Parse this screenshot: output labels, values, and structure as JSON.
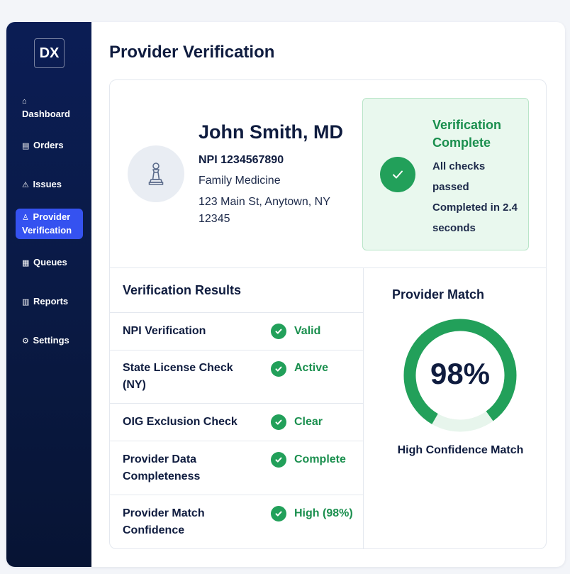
{
  "colors": {
    "sidebar_bg": "#0a1a45",
    "nav_active": "#3552f0",
    "success": "#22a05a",
    "success_text": "#1a8f4e",
    "success_bg": "#e9f8ee",
    "text_primary": "#0f1c3f"
  },
  "sidebar": {
    "logo": "DX",
    "items": [
      {
        "icon": "⌂",
        "icon_name": "home-icon",
        "label": "Dashboard",
        "active": false
      },
      {
        "icon": "▤",
        "icon_name": "orders-icon",
        "label": "Orders",
        "active": false
      },
      {
        "icon": "⚠",
        "icon_name": "warning-icon",
        "label": "Issues",
        "active": false
      },
      {
        "icon": "♙",
        "icon_name": "user-icon",
        "label": "Provider Verification",
        "active": true
      },
      {
        "icon": "▦",
        "icon_name": "queues-icon",
        "label": "Queues",
        "active": false
      },
      {
        "icon": "▥",
        "icon_name": "reports-icon",
        "label": "Reports",
        "active": false
      },
      {
        "icon": "⚙",
        "icon_name": "gear-icon",
        "label": "Settings",
        "active": false
      }
    ]
  },
  "page": {
    "title": "Provider Verification"
  },
  "provider": {
    "name": "John Smith, MD",
    "npi": "NPI 1234567890",
    "specialty": "Family Medicine",
    "address": "123 Main St, Anytown, NY 12345",
    "avatar_icon": "chess-pawn-icon"
  },
  "status": {
    "title": "Verification Complete",
    "line1": "All checks passed",
    "line2": "Completed in 2.4 seconds"
  },
  "results": {
    "title": "Verification Results",
    "rows": [
      {
        "label": "NPI Verification",
        "value": "Valid"
      },
      {
        "label": "State License Check (NY)",
        "value": "Active"
      },
      {
        "label": "OIG Exclusion Check",
        "value": "Clear"
      },
      {
        "label": "Provider Data Completeness",
        "value": "Complete"
      },
      {
        "label": "Provider Match Confidence",
        "value": "High (98%)"
      }
    ]
  },
  "match": {
    "title": "Provider Match",
    "percent": 98,
    "value_text": "98%",
    "caption": "High Confidence Match"
  }
}
